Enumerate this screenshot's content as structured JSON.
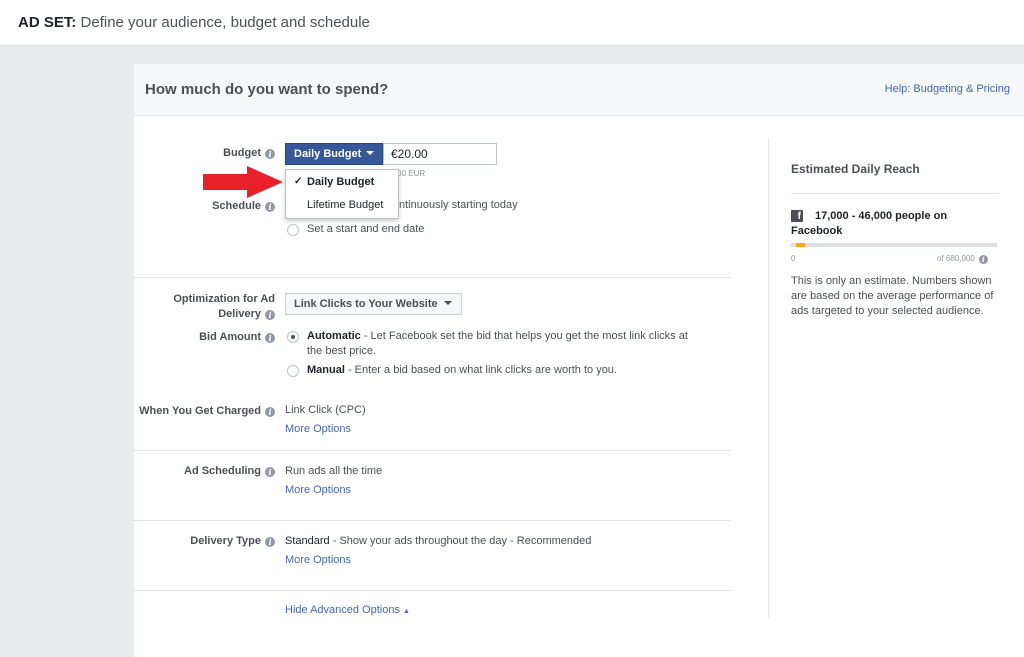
{
  "header": {
    "prefix": "AD SET:",
    "title": "Define your audience, budget and schedule"
  },
  "section": {
    "heading": "How much do you want to spend?",
    "help_link": "Help: Budgeting & Pricing"
  },
  "budget": {
    "label": "Budget",
    "type_button": "Daily Budget",
    "amount": "€20.00",
    "sub_text": "20.00 EUR",
    "options": [
      "Daily Budget",
      "Lifetime Budget"
    ],
    "selected_option": "Daily Budget"
  },
  "schedule": {
    "label": "Schedule",
    "option1": "ntinuously starting today",
    "option2": "Set a start and end date"
  },
  "optimization": {
    "label_line1": "Optimization for Ad",
    "label_line2": "Delivery",
    "value": "Link Clicks to Your Website"
  },
  "bid": {
    "label": "Bid Amount",
    "automatic_title": "Automatic",
    "automatic_desc_1": " - Let Facebook set the bid that helps you get the most link clicks at",
    "automatic_desc_2": "the best price.",
    "manual_title": "Manual",
    "manual_desc": " - Enter a bid based on what link clicks are worth to you."
  },
  "charged": {
    "label": "When You Get Charged",
    "value": "Link Click (CPC)",
    "more": "More Options"
  },
  "ad_scheduling": {
    "label": "Ad Scheduling",
    "value": "Run ads all the time",
    "more": "More Options"
  },
  "delivery": {
    "label": "Delivery Type",
    "value": "Standard",
    "desc": " - Show your ads throughout the day - Recommended",
    "more": "More Options"
  },
  "advanced_link": "Hide Advanced Options",
  "reach": {
    "title": "Estimated Daily Reach",
    "people": "17,000 - 46,000 people on Facebook",
    "fb_letter": "f",
    "min": "0",
    "max": "of 680,000",
    "range_low_fraction": 0.025,
    "range_high_fraction": 0.068,
    "note": "This is only an estimate. Numbers shown are based on the average performance of ads targeted to your selected audience."
  },
  "colors": {
    "primary_button": "#365899",
    "link": "#4267b2",
    "reach_bar": "#f5a623",
    "arrow": "#e8202a"
  }
}
